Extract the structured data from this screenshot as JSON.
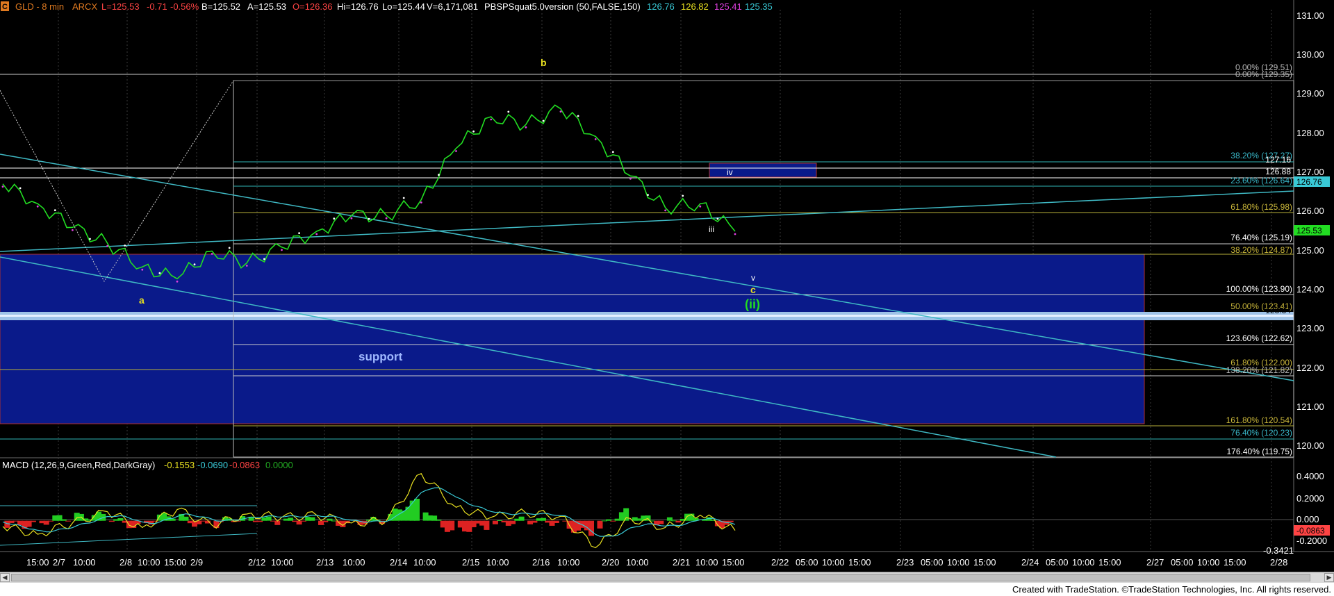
{
  "header": {
    "icon_label": "C",
    "symbol": "GLD - 8 min",
    "exchange": "ARCX",
    "last": "L=125.53",
    "chg": "-0.71",
    "pct": "-0.56%",
    "bid": "B=125.52",
    "ask": "A=125.53",
    "open": "O=126.36",
    "high": "Hi=126.76",
    "low": "Lo=125.44",
    "vol": "V=6,171,081",
    "indicator": "PBSPSquat5.0version (50,FALSE,150)",
    "ind_vals": [
      "126.76",
      "126.82",
      "125.41",
      "125.35"
    ]
  },
  "price_axis": {
    "ticks": [
      "131.00",
      "130.00",
      "129.00",
      "128.00",
      "127.00",
      "126.00",
      "125.00",
      "124.00",
      "123.00",
      "122.00",
      "121.00",
      "120.00"
    ],
    "tags": [
      "126.76",
      "125.53",
      "127.16",
      "126.88",
      "123.34"
    ]
  },
  "fib_labels": [
    "0.00% (129.51)",
    "0.00% (129.35)",
    "38.20% (127.27)",
    "23.60% (126.64)",
    "61.80% (125.98)",
    "76.40% (125.19)",
    "38.20% (124.87)",
    "100.00% (123.90)",
    "50.00% (123.41)",
    "123.60% (122.62)",
    "61.80% (122.00)",
    "138.20% (121.82)",
    "161.80% (120.54)",
    "76.40% (120.23)",
    "176.40% (119.75)"
  ],
  "wave_labels": {
    "a": "a",
    "b": "b",
    "iii": "iii",
    "iv": "iv",
    "v": "v",
    "c": "c",
    "ii": "(ii)"
  },
  "zone_label": "support",
  "macd": {
    "label": "MACD (12,26,9,Green,Red,DarkGray)",
    "vals": [
      "-0.1553",
      "-0.0690",
      "-0.0863",
      "0.0000"
    ],
    "ticks": [
      "0.4000",
      "0.2000",
      "0.000",
      "-0.2000",
      "-0.3421"
    ],
    "tag": "-0.0863"
  },
  "time_axis": [
    "15:00",
    "2/7",
    "10:00",
    "2/8",
    "10:00",
    "15:00",
    "2/9",
    "2/12",
    "10:00",
    "2/13",
    "10:00",
    "2/14",
    "10:00",
    "2/15",
    "10:00",
    "2/16",
    "10:00",
    "2/20",
    "10:00",
    "2/21",
    "10:00",
    "15:00",
    "2/22",
    "05:00",
    "10:00",
    "15:00",
    "2/23",
    "05:00",
    "10:00",
    "15:00",
    "2/24",
    "05:00",
    "10:00",
    "15:00",
    "2/27",
    "05:00",
    "10:00",
    "15:00",
    "2/28"
  ],
  "footer": "Created with TradeStation. ©TradeStation Technologies, Inc. All rights reserved.",
  "chart_data": {
    "type": "line",
    "title": "GLD - 8 min",
    "ylim": [
      119.6,
      131.2
    ],
    "y_ticks": [
      120,
      121,
      122,
      123,
      124,
      125,
      126,
      127,
      128,
      129,
      130,
      131
    ],
    "x": [
      "2/6 15:00",
      "2/7",
      "2/7 10:00",
      "2/8",
      "2/8 10:00",
      "2/8 15:00",
      "2/9",
      "2/12",
      "2/12 10:00",
      "2/13",
      "2/13 10:00",
      "2/14",
      "2/14 10:00",
      "2/15",
      "2/15 10:00",
      "2/16",
      "2/16 10:00",
      "2/20",
      "2/20 10:00",
      "2/21",
      "2/21 10:00",
      "2/21 15:00"
    ],
    "series": [
      {
        "values": [
          126.7,
          126.2,
          125.6,
          125.2,
          124.6,
          124.3,
          125.0,
          124.7,
          125.1,
          125.5,
          125.9,
          125.9,
          126.3,
          127.6,
          128.4,
          128.2,
          128.6,
          127.9,
          126.9,
          126.1,
          126.2,
          125.5
        ]
      }
    ],
    "support_zone": [
      120.55,
      124.9
    ],
    "resistance_box": [
      126.88,
      127.16
    ],
    "macd": {
      "ylim": [
        -0.3421,
        0.5
      ],
      "values": [
        -0.05,
        -0.12,
        -0.02,
        0.08,
        -0.06,
        0.1,
        -0.04,
        0.06,
        0.03,
        0.05,
        -0.02,
        0.0,
        0.42,
        0.12,
        0.03,
        0.07,
        0.04,
        -0.24,
        0.02,
        -0.06,
        0.05,
        -0.0863
      ]
    }
  }
}
